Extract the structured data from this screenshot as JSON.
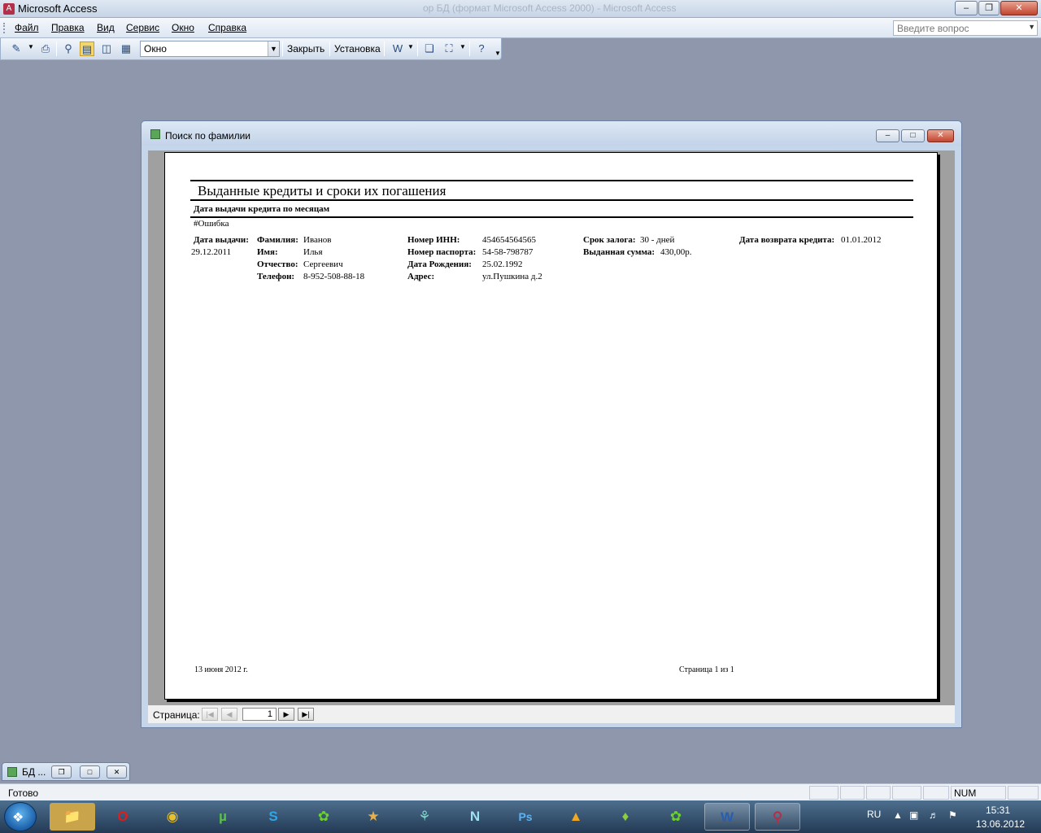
{
  "app": {
    "title": "Microsoft Access",
    "background_title": "ор БД (формат Microsoft Access 2000) - Microsoft Access"
  },
  "menu": {
    "items": [
      "Файл",
      "Правка",
      "Вид",
      "Сервис",
      "Окно",
      "Справка"
    ],
    "help_placeholder": "Введите вопрос"
  },
  "toolbar": {
    "zoom_value": "Окно",
    "close_label": "Закрыть",
    "setup_label": "Установка"
  },
  "child_window": {
    "title": "Поиск по фамилии"
  },
  "report": {
    "title": "Выданные кредиты и сроки их погашения",
    "group_header": "Дата выдачи кредита по месяцам",
    "group_value": "#Ошибка",
    "issue_date_label": "Дата выдачи:",
    "issue_date_value": "29.12.2011",
    "surname_label": "Фамилия:",
    "surname_value": "Иванов",
    "name_label": "Имя:",
    "name_value": "Илья",
    "patronymic_label": "Отчество:",
    "patronymic_value": "Сергеевич",
    "phone_label": "Телефон:",
    "phone_value": "8-952-508-88-18",
    "inn_label": "Номер ИНН:",
    "inn_value": "454654564565",
    "passport_label": "Номер паспорта:",
    "passport_value": "54-58-798787",
    "birth_label": "Дата Рождения:",
    "birth_value": "25.02.1992",
    "address_label": "Адрес:",
    "address_value": "ул.Пушкина д.2",
    "pledge_label": "Срок залога:",
    "pledge_value": "30 - дней",
    "amount_label": "Выданная сумма:",
    "amount_value": "430,00р.",
    "return_label": "Дата возврата кредита:",
    "return_value": "01.01.2012",
    "footer_date": "13 июня 2012 г.",
    "footer_page": "Страница 1 из 1"
  },
  "navigation": {
    "label": "Страница:",
    "current_page": "1"
  },
  "minimized_window": {
    "title": "БД ..."
  },
  "status": {
    "text": "Готово",
    "num": "NUM"
  },
  "taskbar": {
    "lang": "RU",
    "time": "15:31",
    "date": "13.06.2012",
    "apps": [
      "explorer",
      "opera",
      "chrome",
      "utorrent",
      "skype",
      "icq",
      "game",
      "app",
      "nero",
      "photoshop",
      "aimp",
      "app2",
      "icq2",
      "word",
      "access"
    ]
  },
  "colors": {
    "desktop_bg": "#8f97ad",
    "taskbar": "#233a55",
    "close_button": "#c2452e"
  }
}
